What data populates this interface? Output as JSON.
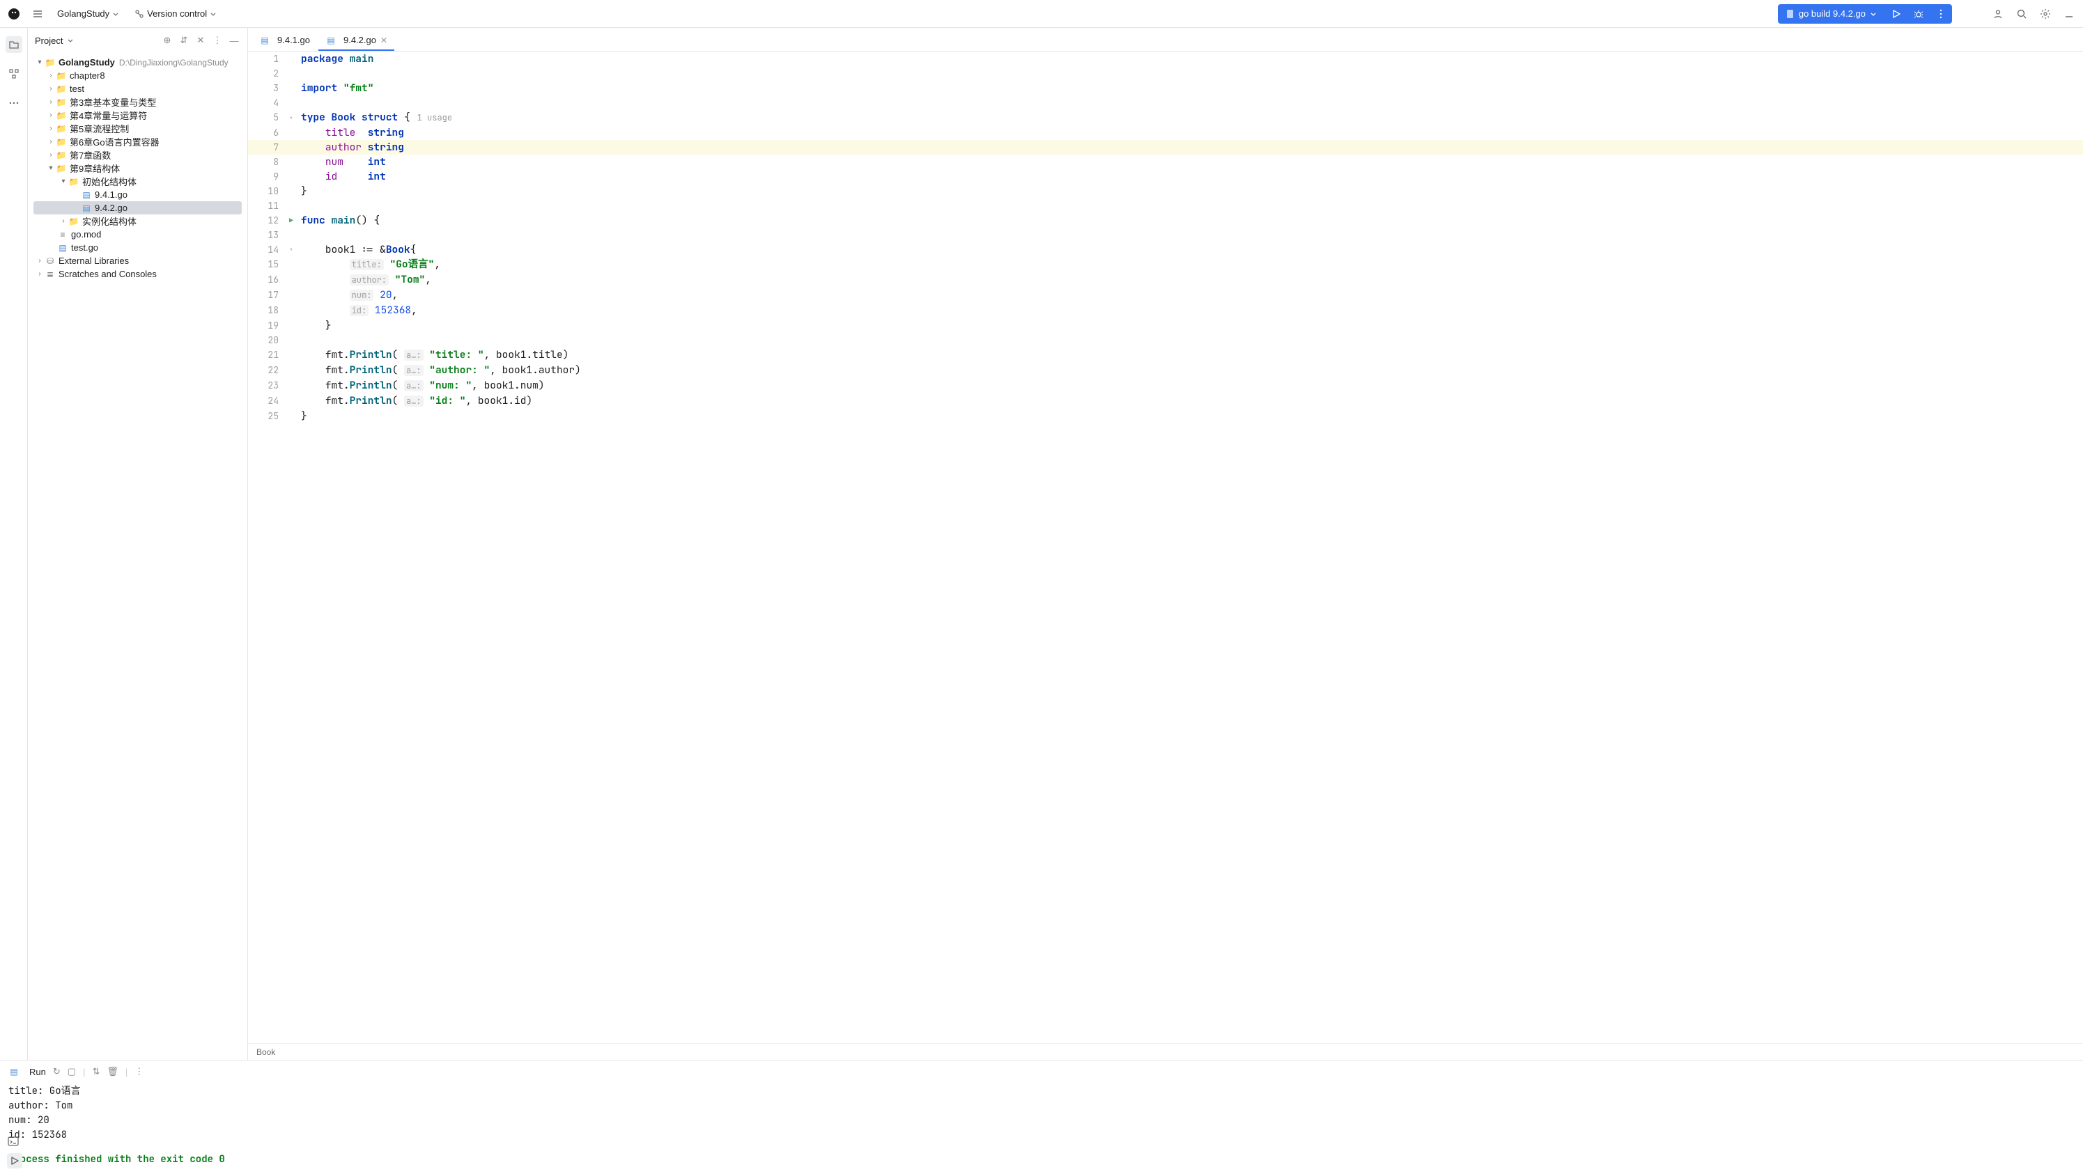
{
  "topbar": {
    "project": "GolangStudy",
    "vc": "Version control",
    "run_config": "go build 9.4.2.go"
  },
  "sidebar": {
    "title": "Project",
    "root": {
      "name": "GolangStudy",
      "path": "D:\\DingJiaxiong\\GolangStudy"
    },
    "folders": {
      "chapter8": "chapter8",
      "test": "test",
      "ch3": "第3章基本变量与类型",
      "ch4": "第4章常量与运算符",
      "ch5": "第5章流程控制",
      "ch6": "第6章Go语言内置容器",
      "ch7": "第7章函数",
      "ch9": "第9章结构体",
      "init_struct": "初始化结构体",
      "inst_struct": "实例化结构体"
    },
    "files": {
      "f941": "9.4.1.go",
      "f942": "9.4.2.go",
      "gomod": "go.mod",
      "testgo": "test.go"
    },
    "ext_lib": "External Libraries",
    "scratches": "Scratches and Consoles"
  },
  "tabs": {
    "t1": "9.4.1.go",
    "t2": "9.4.2.go"
  },
  "editor": {
    "lines": [
      "1",
      "2",
      "3",
      "4",
      "5",
      "6",
      "7",
      "8",
      "9",
      "10",
      "11",
      "12",
      "13",
      "14",
      "15",
      "16",
      "17",
      "18",
      "19",
      "20",
      "21",
      "22",
      "23",
      "24",
      "25"
    ],
    "package_kw": "package",
    "package_name": "main",
    "import_kw": "import",
    "import_val": "\"fmt\"",
    "type_kw": "type",
    "book": "Book",
    "struct_kw": "struct",
    "lb": "{",
    "rb": "}",
    "usage_txt": "1 usage",
    "f_title": "title",
    "f_author": "author",
    "f_num": "num",
    "f_id": "id",
    "string_ty": "string",
    "int_ty": "int",
    "func_kw": "func",
    "main_fn": "main",
    "paren": "()",
    "space": " ",
    "book1": "book1",
    "assign": " := &",
    "comma": ",",
    "h_title": "title:",
    "h_author": "author:",
    "h_num": "num:",
    "h_id": "id:",
    "v_title": "\"Go语言\"",
    "v_author": "\"Tom\"",
    "v_num": "20",
    "v_id": "152368",
    "fmt": "fmt",
    "dot": ".",
    "println": "Println",
    "lp": "(",
    "rp": ")",
    "a_hint": "a…:",
    "s_title": "\"title: \"",
    "s_author": "\"author: \"",
    "s_num": "\"num: \"",
    "s_id": "\"id: \"",
    "b1_title": "book1.title",
    "b1_author": "book1.author",
    "b1_num": "book1.num",
    "b1_id": "book1.id",
    "breadcrumb": "Book"
  },
  "run": {
    "label": "Run",
    "out_title": "title:  Go语言",
    "out_author": "author:  Tom",
    "out_num": "num:  20",
    "out_id": "id:  152368",
    "finish": "Process finished with the exit code 0"
  }
}
